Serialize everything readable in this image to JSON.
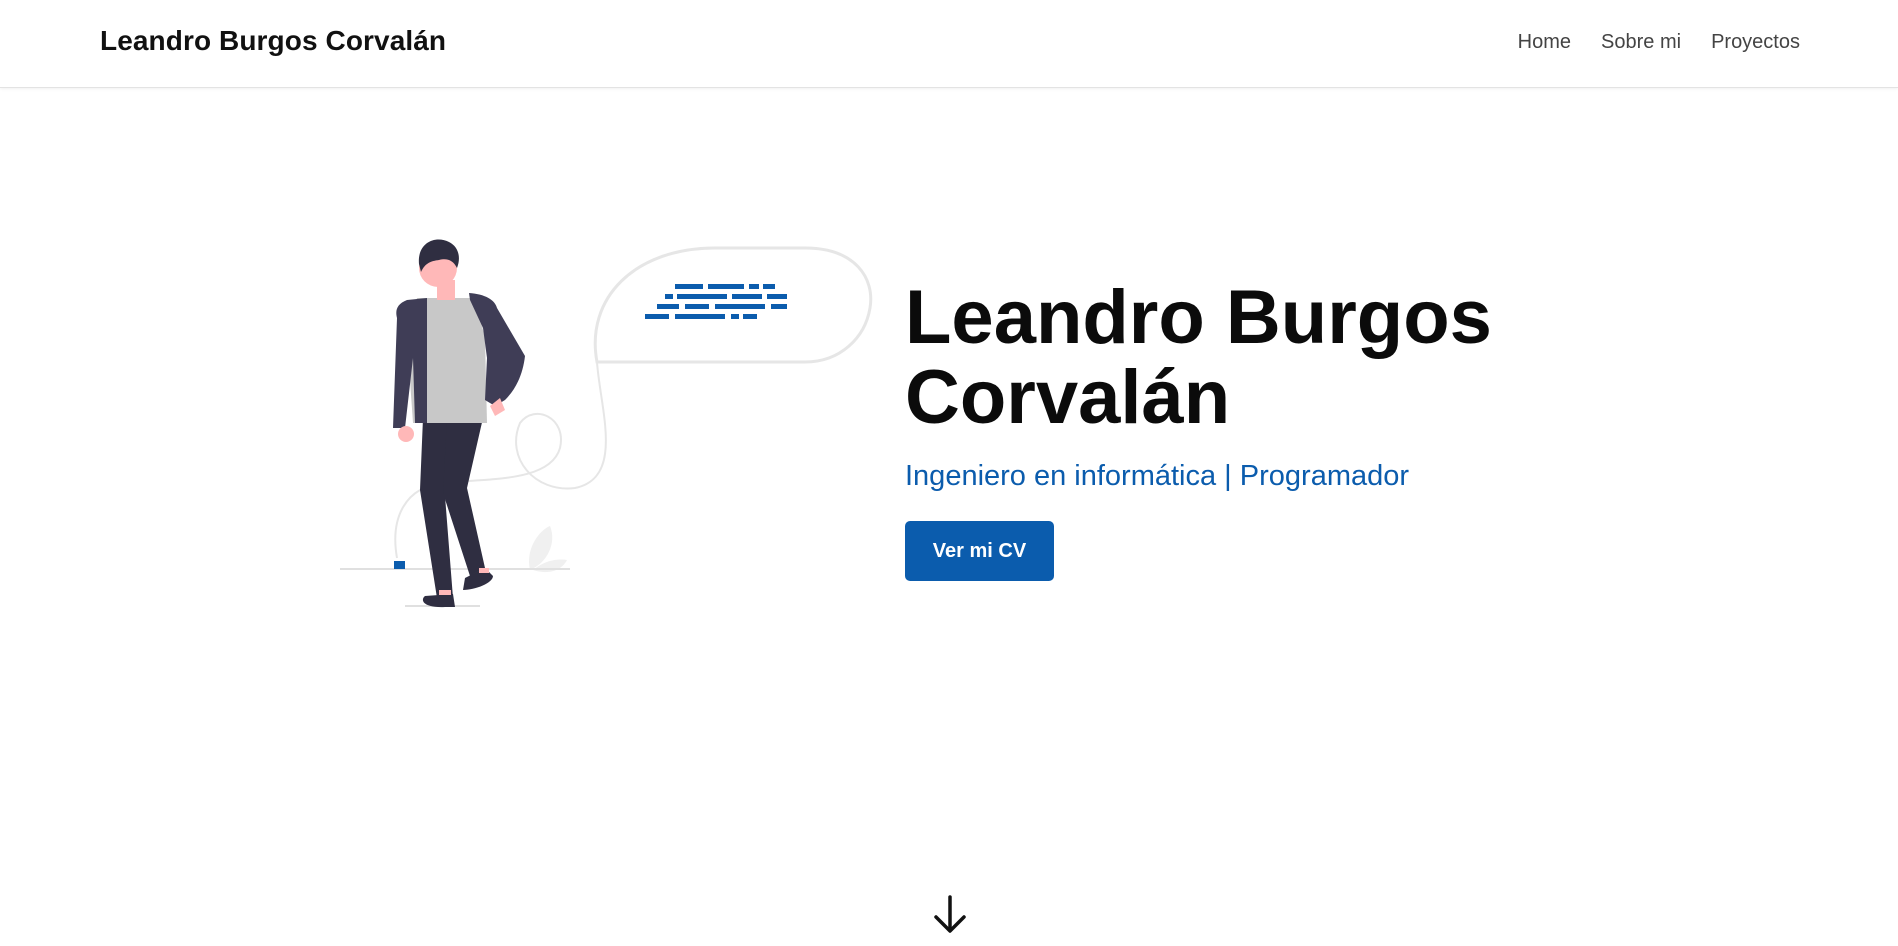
{
  "navbar": {
    "brand": "Leandro Burgos Corvalán",
    "links": [
      {
        "label": "Home"
      },
      {
        "label": "Sobre mi"
      },
      {
        "label": "Proyectos"
      }
    ]
  },
  "hero": {
    "title_line1": "Leandro Burgos",
    "title_line2": "Corvalán",
    "subtitle": "Ingeniero en informática | Programador",
    "cv_button_label": "Ver mi CV",
    "illustration_icon": "programmer-illustration"
  },
  "scroll": {
    "icon": "arrow-down-icon"
  },
  "colors": {
    "accent": "#0b5cad",
    "text": "#0b0b0b",
    "nav_text": "#444444",
    "figure_dark": "#3f3d56",
    "figure_shirt": "#c8c8c8",
    "skin": "#ffb8b8"
  }
}
